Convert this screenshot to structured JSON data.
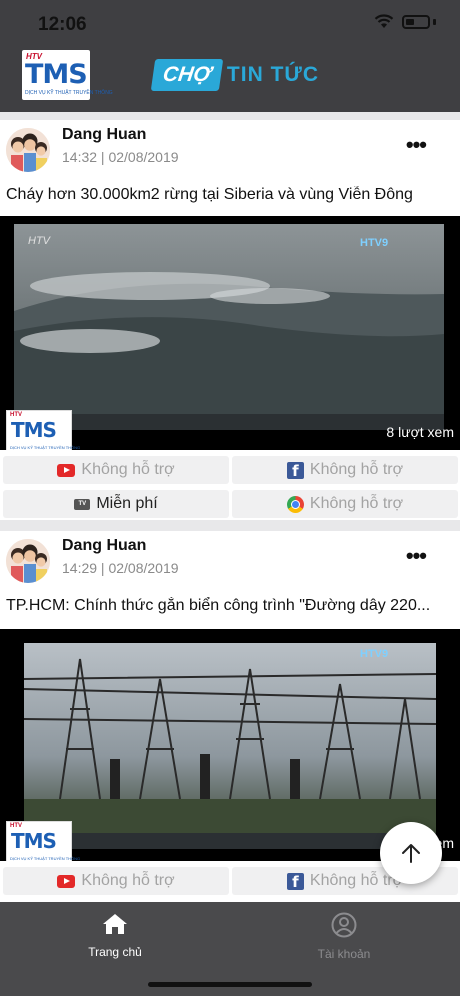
{
  "status_bar": {
    "time": "12:06"
  },
  "header": {
    "tms_logo": {
      "htv": "HTV",
      "name": "TMS",
      "sub": "DỊCH VỤ KỸ THUẬT TRUYỀN THÔNG"
    },
    "brand": {
      "part1": "CHỢ",
      "part2": "TIN TỨC"
    }
  },
  "posts": [
    {
      "author": "Dang Huan",
      "time": "14:32 | 02/08/2019",
      "title": "Cháy hơn 30.000km2 rừng tại Siberia và vùng Viễn Đông",
      "views": "8 lượt xem",
      "actions": [
        {
          "icon": "youtube-icon",
          "label": "Không hỗ trợ"
        },
        {
          "icon": "facebook-icon",
          "label": "Không hỗ trợ"
        },
        {
          "icon": "tv-icon",
          "label": "Miễn phí"
        },
        {
          "icon": "chrome-icon",
          "label": "Không hỗ trợ"
        }
      ]
    },
    {
      "author": "Dang Huan",
      "time": "14:29 | 02/08/2019",
      "title": "TP.HCM: Chính thức gắn biển công trình \"Đường dây 220...",
      "views": "em",
      "actions": [
        {
          "icon": "youtube-icon",
          "label": "Không hỗ trợ"
        },
        {
          "icon": "facebook-icon",
          "label": "Không hỗ trợ"
        }
      ]
    }
  ],
  "tabbar": {
    "home": "Trang chủ",
    "account": "Tài khoản"
  },
  "colors": {
    "accent": "#2aa8d8",
    "header_bg": "#3f3f42",
    "tab_active": "#ffffff",
    "tab_inactive": "#8c8c8f"
  }
}
